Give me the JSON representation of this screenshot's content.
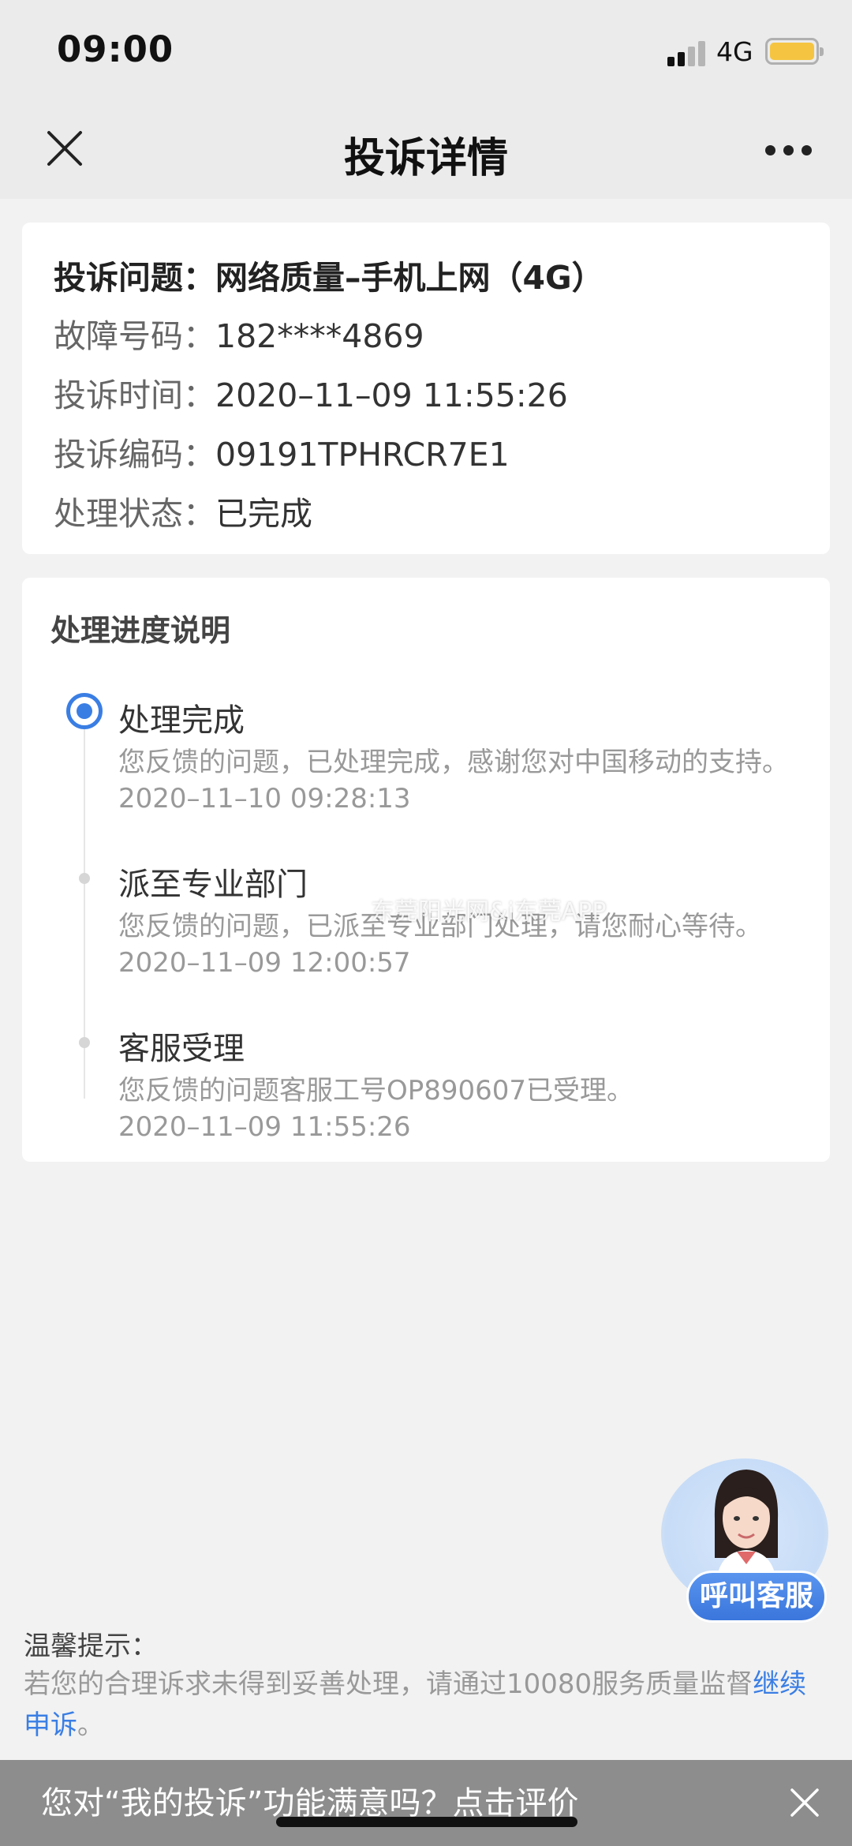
{
  "status_bar": {
    "time": "09:00",
    "network": "4G"
  },
  "nav": {
    "title": "投诉详情"
  },
  "complaint": {
    "issue": {
      "label": "投诉问题：",
      "value": "网络质量–手机上网（4G）"
    },
    "fault_number": {
      "label": "故障号码：",
      "value": "182****4869"
    },
    "time": {
      "label": "投诉时间：",
      "value": "2020–11–09 11:55:26"
    },
    "code": {
      "label": "投诉编码：",
      "value": "09191TPHRCR7E1"
    },
    "status": {
      "label": "处理状态：",
      "value": "已完成"
    }
  },
  "progress": {
    "heading": "处理进度说明",
    "steps": [
      {
        "title": "处理完成",
        "desc": "您反馈的问题，已处理完成，感谢您对中国移动的支持。",
        "time": "2020–11–10 09:28:13"
      },
      {
        "title": "派至专业部门",
        "desc": "您反馈的问题，已派至专业部门处理，请您耐心等待。",
        "time": "2020–11–09 12:00:57"
      },
      {
        "title": "客服受理",
        "desc": "您反馈的问题客服工号OP890607已受理。",
        "time": "2020–11–09 11:55:26"
      }
    ]
  },
  "watermark": "东莞阳光网&i东莞APP",
  "service": {
    "button_label": "呼叫客服"
  },
  "tips": {
    "heading": "温馨提示：",
    "text": "若您的合理诉求未得到妥善处理，请通过10080服务质量监督",
    "link": "继续申诉",
    "end": "。"
  },
  "feedback": {
    "text": "您对“我的投诉”功能满意吗？点击评价"
  },
  "colors": {
    "accent": "#3a7ee4",
    "battery": "#f5c542",
    "banner": "#8d8d8d"
  },
  "icons": [
    "signal-icon",
    "battery-icon",
    "close-icon",
    "more-icon",
    "timeline-active-icon",
    "service-avatar",
    "banner-close-icon"
  ]
}
